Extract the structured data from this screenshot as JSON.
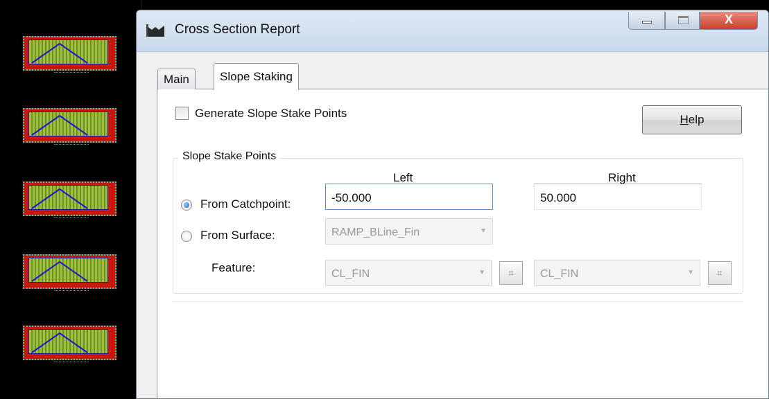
{
  "window": {
    "title": "Cross Section Report",
    "close_glyph": "X"
  },
  "tabs": [
    {
      "label": "Main",
      "selected": false
    },
    {
      "label": "Slope Staking",
      "selected": true
    }
  ],
  "generate": {
    "label": "Generate Slope Stake Points",
    "checked": false
  },
  "help": {
    "mnemonic": "H",
    "rest": "elp"
  },
  "group": {
    "title": "Slope Stake Points",
    "left_header": "Left",
    "right_header": "Right"
  },
  "from_catchpoint": {
    "label": "From Catchpoint:",
    "selected": true,
    "left_value": "-50.000",
    "right_value": "50.000"
  },
  "from_surface": {
    "label": "From Surface:",
    "selected": false,
    "surface_value": "RAMP_BLine_Fin"
  },
  "feature": {
    "label": "Feature:",
    "left_value": "CL_FIN",
    "right_value": "CL_FIN"
  },
  "icons": {
    "app": "cross-section-icon",
    "pick": "target-pick-icon"
  },
  "colors": {
    "titlebar": "#c9d9ec",
    "close_button": "#c7402b",
    "cad_background": "#000000",
    "cad_frame": "#c8180c",
    "cad_border": "#27d4c8"
  }
}
